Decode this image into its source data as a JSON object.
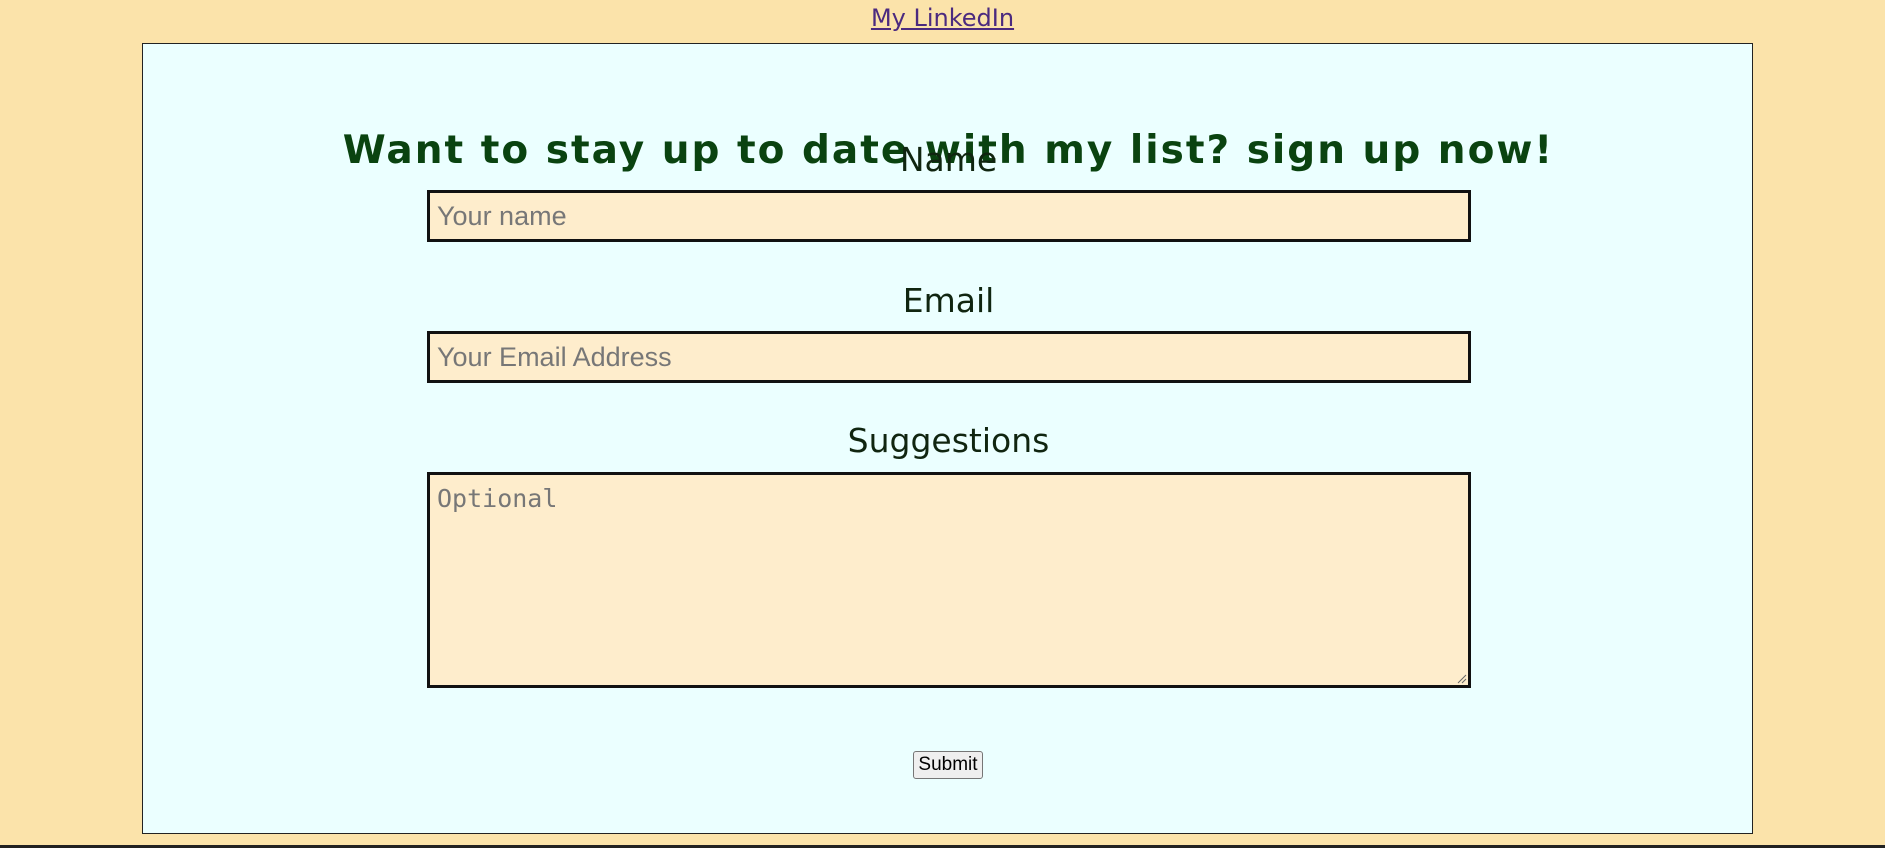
{
  "header": {
    "link_label": "My LinkedIn"
  },
  "form": {
    "title": "Want to stay up to date with my list? sign up now!",
    "name_label": "Name",
    "name_placeholder": "Your name",
    "email_label": "Email",
    "email_placeholder": "Your Email Address",
    "suggestions_label": "Suggestions",
    "suggestions_placeholder": "Optional",
    "submit_label": "Submit"
  },
  "colors": {
    "page_background": "#fbe3aa",
    "panel_background": "#ebffff",
    "heading_color": "#0a4310",
    "input_background": "#feedcc",
    "link_color": "#4b2a7f"
  },
  "icons": {
    "textarea_resize": "resize-grip-icon"
  }
}
